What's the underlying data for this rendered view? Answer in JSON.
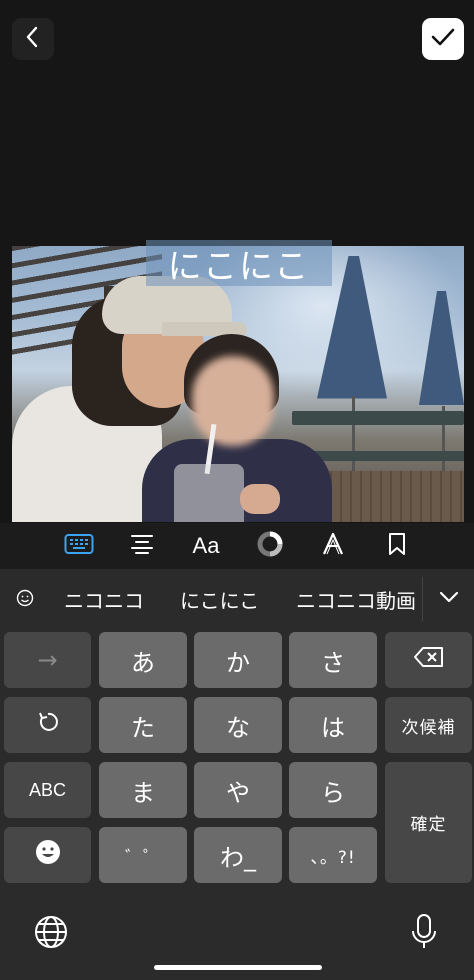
{
  "header": {
    "back_icon": "chevron-left-icon",
    "confirm_icon": "checkmark-icon"
  },
  "photo": {
    "overlay_text": "にこにこ"
  },
  "edit_toolbar": {
    "tools": [
      {
        "name": "keyboard-icon"
      },
      {
        "name": "align-center-icon"
      },
      {
        "name": "font",
        "label": "Aa"
      },
      {
        "name": "color-wheel-icon"
      },
      {
        "name": "text-style-icon",
        "label": "A"
      },
      {
        "name": "bookmark-icon"
      }
    ]
  },
  "keyboard": {
    "candidates": [
      "ニコニコ",
      "にこにこ",
      "ニコニコ動画"
    ],
    "keys": {
      "next_arrow": "→",
      "a": "あ",
      "ka": "か",
      "sa": "さ",
      "ta": "た",
      "na": "な",
      "ha": "は",
      "next_candidate": "次候補",
      "abc": "ABC",
      "ma": "ま",
      "ya": "や",
      "ra": "ら",
      "confirm": "確定",
      "dakuten": "゛゜",
      "wa": "わ_",
      "punct": "、。?!"
    }
  }
}
